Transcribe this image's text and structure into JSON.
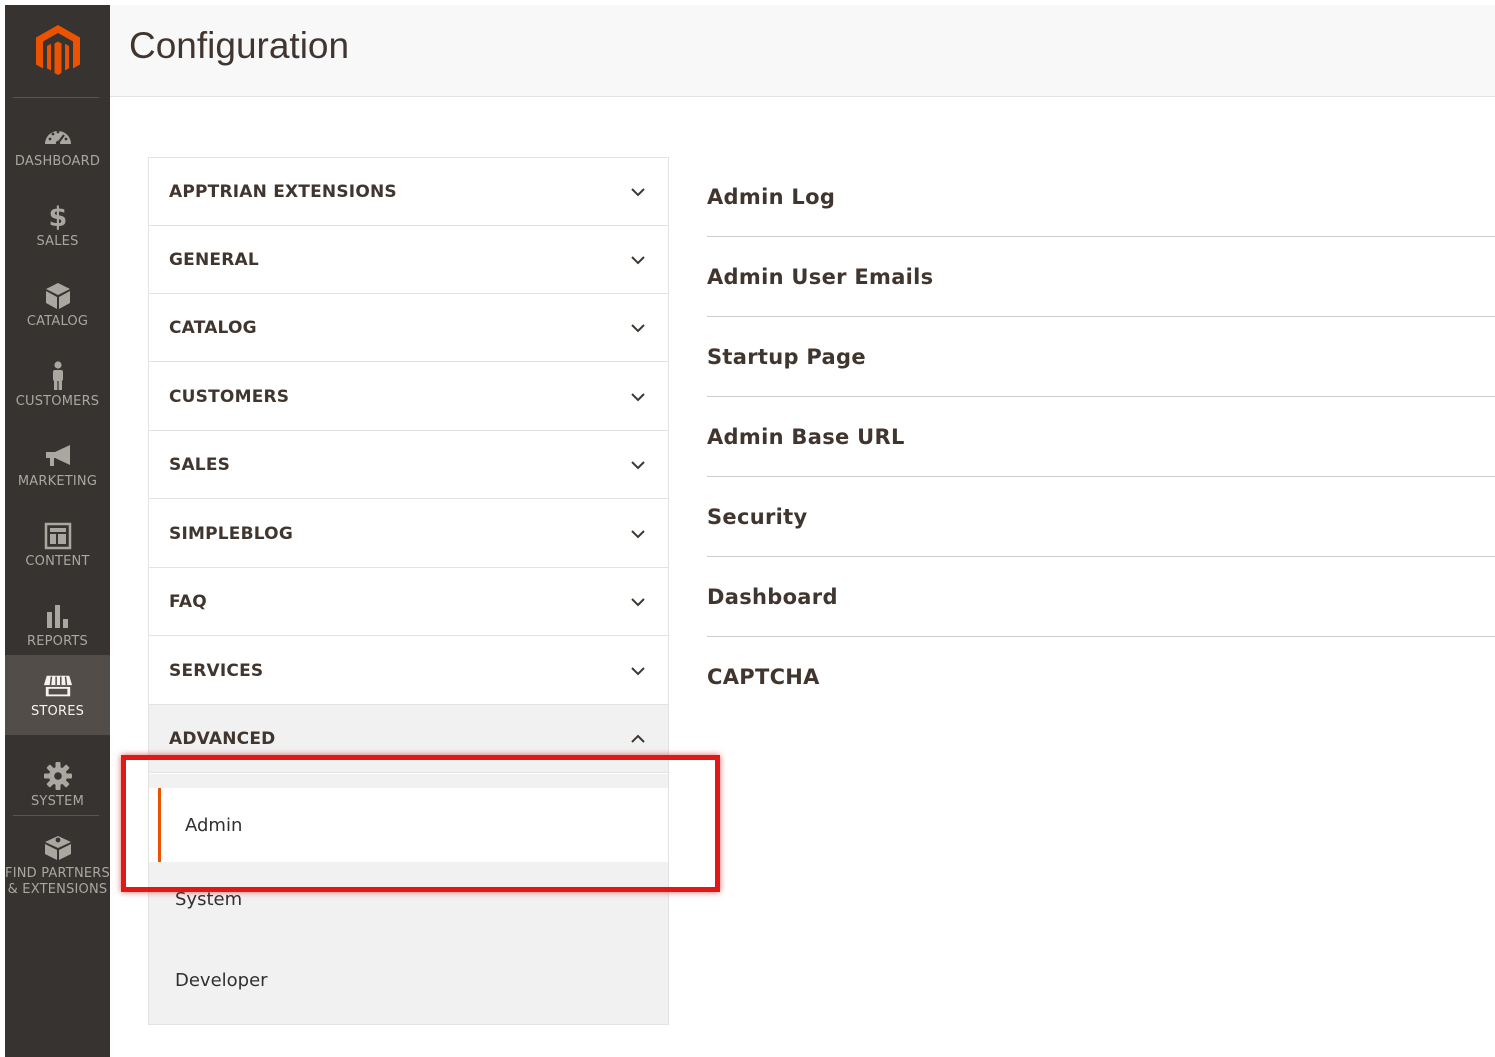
{
  "header": {
    "title": "Configuration"
  },
  "sidebar": {
    "items": [
      {
        "name": "dashboard",
        "label": "DASHBOARD",
        "active": false
      },
      {
        "name": "sales",
        "label": "SALES",
        "active": false
      },
      {
        "name": "catalog",
        "label": "CATALOG",
        "active": false
      },
      {
        "name": "customers",
        "label": "CUSTOMERS",
        "active": false
      },
      {
        "name": "marketing",
        "label": "MARKETING",
        "active": false
      },
      {
        "name": "content",
        "label": "CONTENT",
        "active": false
      },
      {
        "name": "reports",
        "label": "REPORTS",
        "active": false
      },
      {
        "name": "stores",
        "label": "STORES",
        "active": true
      },
      {
        "name": "system",
        "label": "SYSTEM",
        "active": false
      },
      {
        "name": "partners",
        "label_line1": "FIND PARTNERS",
        "label_line2": "& EXTENSIONS",
        "active": false
      }
    ]
  },
  "tabs": [
    {
      "label": "APPTRIAN EXTENSIONS",
      "open": false
    },
    {
      "label": "GENERAL",
      "open": false
    },
    {
      "label": "CATALOG",
      "open": false
    },
    {
      "label": "CUSTOMERS",
      "open": false
    },
    {
      "label": "SALES",
      "open": false
    },
    {
      "label": "SIMPLEBLOG",
      "open": false
    },
    {
      "label": "FAQ",
      "open": false
    },
    {
      "label": "SERVICES",
      "open": false
    },
    {
      "label": "ADVANCED",
      "open": true
    }
  ],
  "advanced_items": [
    {
      "label": "Admin",
      "active": true
    },
    {
      "label": "System",
      "active": false
    },
    {
      "label": "Developer",
      "active": false
    }
  ],
  "sections": [
    {
      "label": "Admin Log"
    },
    {
      "label": "Admin User Emails"
    },
    {
      "label": "Startup Page"
    },
    {
      "label": "Admin Base URL"
    },
    {
      "label": "Security"
    },
    {
      "label": "Dashboard"
    },
    {
      "label": "CAPTCHA"
    }
  ],
  "colors": {
    "sidebar_bg": "#373330",
    "sidebar_active_bg": "#524d49",
    "logo_orange": "#eb5202",
    "highlight_red": "#e01818",
    "active_marker": "#eb5202"
  }
}
